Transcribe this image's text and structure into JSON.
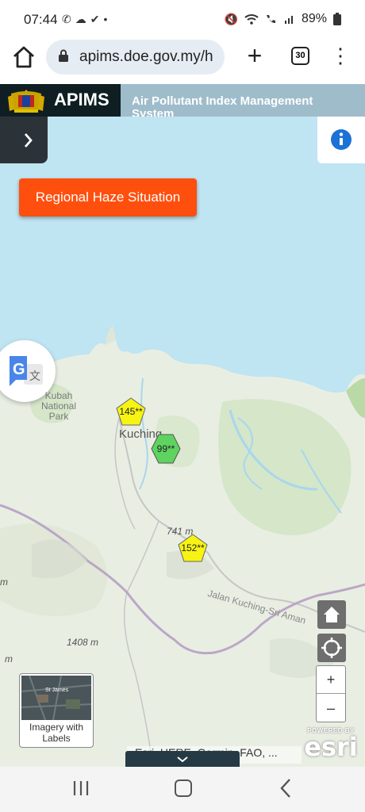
{
  "status_bar": {
    "time": "07:44",
    "notification_icons": [
      "whatsapp-icon",
      "cloud-icon",
      "check-circle-icon",
      "dot-icon"
    ],
    "battery": "89%",
    "right_icons": [
      "mute-icon",
      "wifi-icon",
      "wifi-call-icon",
      "signal-icon",
      "battery-icon"
    ]
  },
  "browser": {
    "url": "apims.doe.gov.my/h",
    "tab_count": "30"
  },
  "header": {
    "brand": "APIMS",
    "subtitle": "Air Pollutant Index Management System"
  },
  "map": {
    "haze_button": "Regional Haze Situation",
    "places": {
      "park": "Kubah National Park",
      "city": "Kuching"
    },
    "elevations": [
      "741 m",
      "1408 m",
      "m",
      "m"
    ],
    "road": "Jalan Kuching-Sri Aman",
    "markers": [
      {
        "value": "145**",
        "level": "unhealthy",
        "color": "#f7f414"
      },
      {
        "value": "99**",
        "level": "moderate",
        "color": "#5fd35f"
      },
      {
        "value": "152**",
        "level": "unhealthy",
        "color": "#f7f414"
      }
    ],
    "basemap_label": "Imagery with Labels",
    "basemap_thumb_text": "St James",
    "attribution": "Esri, HERE, Garmin, FAO, ...",
    "esri_powered": "POWERED BY",
    "esri_logo": "esri",
    "zoom_in": "+",
    "zoom_out": "–"
  },
  "colors": {
    "brand_dark": "#0f1e22",
    "header_bg": "#9fbccb",
    "haze_button": "#ff4f0e",
    "water": "#bfe4f2",
    "land": "#e9eee3"
  }
}
